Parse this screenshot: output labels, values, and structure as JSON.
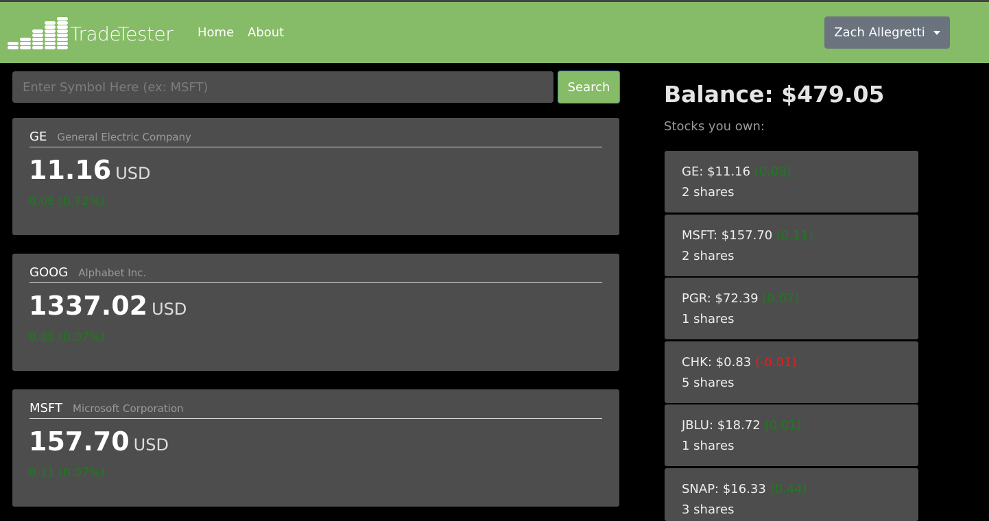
{
  "brand": {
    "name": "TradeTester"
  },
  "nav": {
    "home": "Home",
    "about": "About"
  },
  "user": {
    "name": "Zach Allegretti"
  },
  "search": {
    "placeholder": "Enter Symbol Here (ex: MSFT)",
    "button": "Search"
  },
  "stocks": [
    {
      "symbol": "GE",
      "company": "General Electric Company",
      "price": "11.16",
      "currency": "USD",
      "change": "0.08 (0.72%)"
    },
    {
      "symbol": "GOOG",
      "company": "Alphabet Inc.",
      "price": "1337.02",
      "currency": "USD",
      "change": "0.88 (0.07%)"
    },
    {
      "symbol": "MSFT",
      "company": "Microsoft Corporation",
      "price": "157.70",
      "currency": "USD",
      "change": "0.11 (0.07%)"
    }
  ],
  "portfolio": {
    "balance": "Balance: $479.05",
    "owned_label": "Stocks you own:",
    "holdings": [
      {
        "text": "GE: $11.16",
        "change": "(0.08)",
        "direction": "up",
        "shares": "2 shares"
      },
      {
        "text": "MSFT: $157.70",
        "change": "(0.11)",
        "direction": "up",
        "shares": "2 shares"
      },
      {
        "text": "PGR: $72.39",
        "change": "(0.07)",
        "direction": "up",
        "shares": "1 shares"
      },
      {
        "text": "CHK: $0.83",
        "change": "(-0.01)",
        "direction": "down",
        "shares": "5 shares"
      },
      {
        "text": "JBLU: $18.72",
        "change": "(0.01)",
        "direction": "up",
        "shares": "1 shares"
      },
      {
        "text": "SNAP: $16.33",
        "change": "(0.44)",
        "direction": "up",
        "shares": "3 shares"
      }
    ]
  },
  "colors": {
    "navbar": "#86bb67",
    "panel": "#4d4d4d",
    "positive": "#1f7a1f",
    "negative": "#e02020"
  }
}
